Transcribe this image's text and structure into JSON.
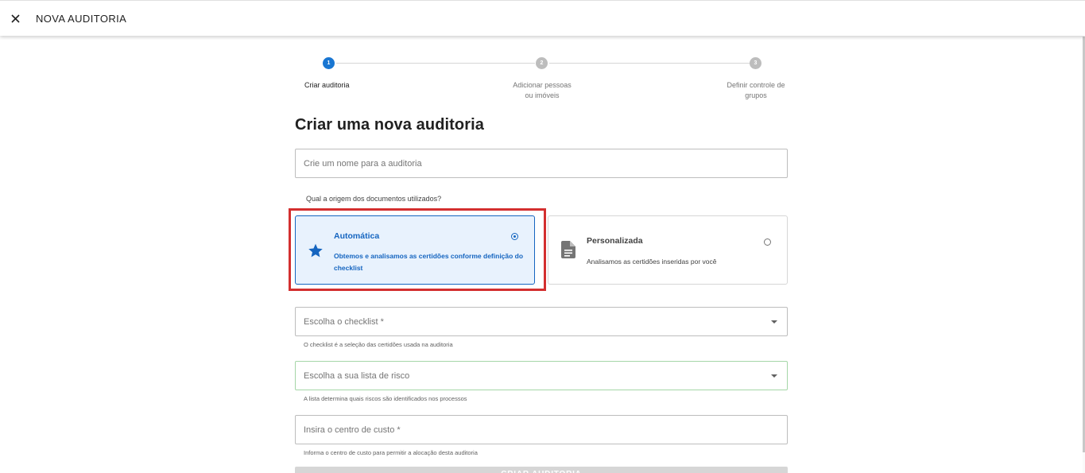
{
  "header": {
    "title": "NOVA AUDITORIA"
  },
  "stepper": {
    "steps": [
      {
        "number": "1",
        "label": "Criar auditoria",
        "state": "active"
      },
      {
        "number": "2",
        "label_line1": "Adicionar pessoas",
        "label_line2": "ou imóveis",
        "state": "inactive"
      },
      {
        "number": "3",
        "label_line1": "Definir controle de",
        "label_line2": "grupos",
        "state": "inactive"
      }
    ]
  },
  "main": {
    "title": "Criar uma nova auditoria",
    "name_field": {
      "placeholder": "Crie um nome para a auditoria",
      "value": ""
    },
    "origin_question": "Qual a origem dos documentos utilizados?",
    "options": [
      {
        "title": "Automática",
        "description": "Obtemos e analisamos as certidões conforme definição do checklist",
        "icon": "star-icon",
        "selected": true
      },
      {
        "title": "Personalizada",
        "description": "Analisamos as certidões inseridas por você",
        "icon": "document-icon",
        "selected": false
      }
    ],
    "checklist_select": {
      "label": "Escolha o checklist *",
      "helper": "O checklist é a seleção das certidões usada na auditoria"
    },
    "risk_list_select": {
      "label": "Escolha a sua lista de risco",
      "helper": "A lista determina quais riscos são identificados nos processos"
    },
    "cost_center_field": {
      "placeholder": "Insira o centro de custo *",
      "helper": "Informa o centro de custo para permitir a alocação desta auditoria"
    },
    "submit_label": "CRIAR AUDITORIA"
  },
  "colors": {
    "primary": "#1976d2",
    "selected_card_bg": "#e8f2fd",
    "highlight": "#d32f2f",
    "disabled_button": "#d6d6d6"
  }
}
